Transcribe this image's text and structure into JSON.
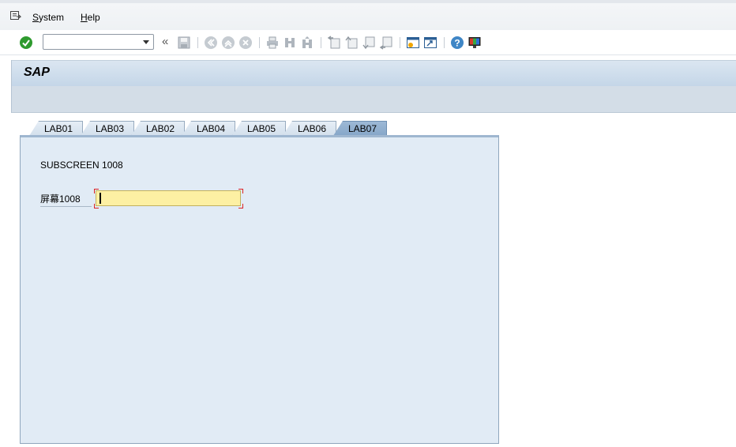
{
  "menu": {
    "items": [
      {
        "label_underlined": "S",
        "label_rest": "ystem"
      },
      {
        "label_underlined": "H",
        "label_rest": "elp"
      }
    ]
  },
  "toolbar": {
    "command_field_value": "",
    "icons": [
      "enter-icon",
      "save-icon",
      "back-icon",
      "exit-icon",
      "cancel-icon",
      "print-icon",
      "find-icon",
      "find-next-icon",
      "first-page-icon",
      "previous-page-icon",
      "next-page-icon",
      "last-page-icon",
      "new-session-icon",
      "shortcut-icon",
      "help-icon",
      "customize-layout-icon"
    ]
  },
  "title": {
    "text": "SAP"
  },
  "tabs": [
    {
      "label": "LAB01",
      "active": false
    },
    {
      "label": "LAB03",
      "active": false
    },
    {
      "label": "LAB02",
      "active": false
    },
    {
      "label": "LAB04",
      "active": false
    },
    {
      "label": "LAB05",
      "active": false
    },
    {
      "label": "LAB06",
      "active": false
    },
    {
      "label": "LAB07",
      "active": true
    }
  ],
  "panel": {
    "subscreen_label": "SUBSCREEN 1008",
    "field_label": "屏幕1008",
    "field_value": ""
  },
  "colors": {
    "accent_active_tab": "#8fadcc",
    "input_background": "#fdf0a3",
    "panel_background": "#e1ebf5",
    "enter_icon_green": "#2e9a2e"
  }
}
